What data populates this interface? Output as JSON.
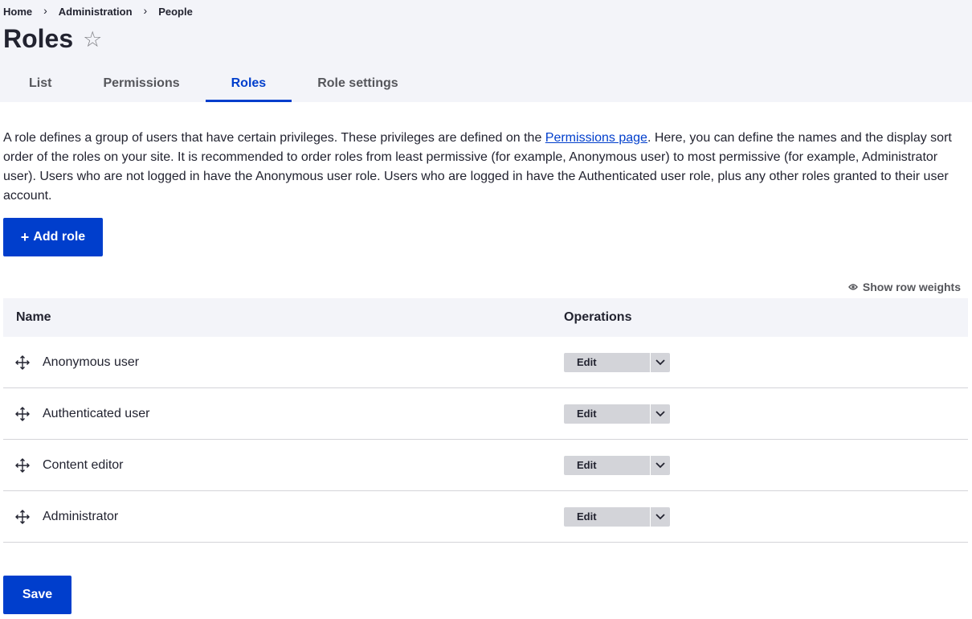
{
  "breadcrumb": [
    "Home",
    "Administration",
    "People"
  ],
  "page": {
    "title": "Roles",
    "star_icon": "star-icon"
  },
  "tabs": [
    {
      "label": "List",
      "active": false
    },
    {
      "label": "Permissions",
      "active": false
    },
    {
      "label": "Roles",
      "active": true
    },
    {
      "label": "Role settings",
      "active": false
    }
  ],
  "description": {
    "before_link": "A role defines a group of users that have certain privileges. These privileges are defined on the ",
    "link_text": "Permissions page",
    "after_link": ". Here, you can define the names and the display sort order of the roles on your site. It is recommended to order roles from least permissive (for example, Anonymous user) to most permissive (for example, Administrator user). Users who are not logged in have the Anonymous user role. Users who are logged in have the Authenticated user role, plus any other roles granted to their user account."
  },
  "add_role": {
    "plus": "+",
    "label": "Add role"
  },
  "row_weights": {
    "label": "Show row weights",
    "icon": "eye-icon"
  },
  "table": {
    "headers": {
      "name": "Name",
      "operations": "Operations"
    },
    "rows": [
      {
        "name": "Anonymous user",
        "edit": "Edit"
      },
      {
        "name": "Authenticated user",
        "edit": "Edit"
      },
      {
        "name": "Content editor",
        "edit": "Edit"
      },
      {
        "name": "Administrator",
        "edit": "Edit"
      }
    ]
  },
  "save": {
    "label": "Save"
  },
  "colors": {
    "accent": "#003ecc",
    "header_bg": "#f3f4f9",
    "button_gray": "#d3d4d9"
  }
}
